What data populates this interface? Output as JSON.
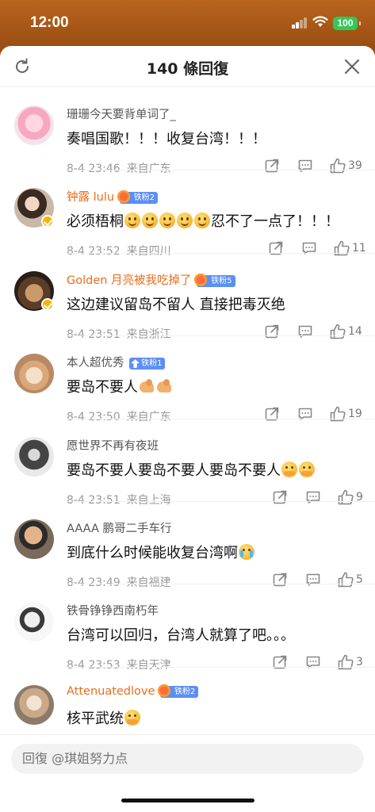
{
  "status_bar": {
    "time": "12:00",
    "battery": "100"
  },
  "header": {
    "title": "140 條回復"
  },
  "comments": [
    {
      "user": "珊珊今天要背单词了_",
      "content": "奏唱国歌！！！收复台湾！！！",
      "time": "8-4 23:46",
      "location": "来自广东",
      "likes": "39"
    },
    {
      "user": "钟露 lulu",
      "badge": "铁粉2",
      "content_a": "必须梧桐",
      "content_b": "忍不了一点了！！！",
      "time": "8-4 23:52",
      "location": "来自四川",
      "likes": "11"
    },
    {
      "user": "Golden 月亮被我吃掉了",
      "badge": "铁粉5",
      "content": "这边建议留岛不留人 直接把毒灭绝",
      "time": "8-4 23:51",
      "location": "来自浙江",
      "likes": "14"
    },
    {
      "user": "本人超优秀",
      "badge": "铁粉1",
      "content": "要岛不要人",
      "time": "8-4 23:50",
      "location": "来自广东",
      "likes": "19"
    },
    {
      "user": "愿世界不再有夜班",
      "content": "要岛不要人要岛不要人要岛不要人",
      "time": "8-4 23:51",
      "location": "来自上海",
      "likes": "9"
    },
    {
      "user": "AAAA 鹏哥二手车行",
      "content": "到底什么时候能收复台湾啊",
      "time": "8-4 23:49",
      "location": "来自福建",
      "likes": "5"
    },
    {
      "user": "铁骨铮铮西南朽年",
      "content": "台湾可以回归，台湾人就算了吧。。。",
      "time": "8-4 23:53",
      "location": "来自天津",
      "likes": "3"
    },
    {
      "user": "Attenuatedlove",
      "badge": "铁粉2",
      "content": "核平武统"
    }
  ],
  "reply": {
    "placeholder": "回復 @琪姐努力点"
  }
}
